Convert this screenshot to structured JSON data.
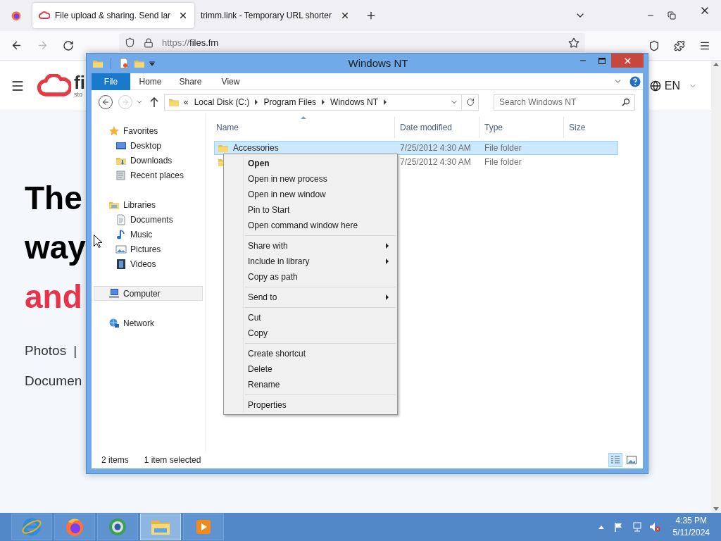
{
  "browser": {
    "tabs": [
      {
        "title": "File upload & sharing. Send lar",
        "selected": true
      },
      {
        "title": "trimm.link - Temporary URL shorter",
        "selected": false
      }
    ],
    "url": {
      "scheme": "https://",
      "host": "files.fm"
    }
  },
  "page": {
    "logo": {
      "text": "fi",
      "tagline": "sto"
    },
    "language": "EN",
    "headline": [
      {
        "text": "The",
        "highlight": false
      },
      {
        "text": "way",
        "highlight": false
      },
      {
        "text": "and",
        "highlight": true
      }
    ],
    "links": [
      "Photos",
      "|"
    ],
    "subline": "Documen"
  },
  "explorer": {
    "title": "Windows NT",
    "ribbon_tabs": [
      {
        "label": "File",
        "selected": true
      },
      {
        "label": "Home",
        "selected": false
      },
      {
        "label": "Share",
        "selected": false
      },
      {
        "label": "View",
        "selected": false
      }
    ],
    "breadcrumb": {
      "overflow": "«",
      "parts": [
        "Local Disk (C:)",
        "Program Files",
        "Windows NT"
      ]
    },
    "search": {
      "placeholder": "Search Windows NT"
    },
    "navigation": [
      {
        "label": "Favorites",
        "selected": false,
        "children": [
          {
            "label": "Desktop",
            "selected": false
          },
          {
            "label": "Downloads",
            "selected": false
          },
          {
            "label": "Recent places",
            "selected": false
          }
        ]
      },
      {
        "label": "Libraries",
        "selected": false,
        "children": [
          {
            "label": "Documents",
            "selected": false
          },
          {
            "label": "Music",
            "selected": false
          },
          {
            "label": "Pictures",
            "selected": false
          },
          {
            "label": "Videos",
            "selected": false
          }
        ]
      },
      {
        "label": "Computer",
        "selected": true
      },
      {
        "label": "Network",
        "selected": false
      }
    ],
    "columns": [
      "Name",
      "Date modified",
      "Type",
      "Size"
    ],
    "files": [
      {
        "name": "Accessories",
        "date": "7/25/2012 4:30 AM",
        "type": "File folder",
        "selected": true
      },
      {
        "date": "7/25/2012 4:30 AM",
        "type": "File folder",
        "selected": false
      }
    ],
    "status": {
      "count": "2 items",
      "selection": "1 item selected"
    },
    "views": [
      {
        "selected": true
      },
      {
        "selected": false
      }
    ]
  },
  "context_menu": {
    "groups": [
      [
        {
          "label": "Open",
          "default": true,
          "submenu": false
        },
        {
          "label": "Open in new process",
          "default": false,
          "submenu": false
        },
        {
          "label": "Open in new window",
          "default": false,
          "submenu": false
        },
        {
          "label": "Pin to Start",
          "default": false,
          "submenu": false
        },
        {
          "label": "Open command window here",
          "default": false,
          "submenu": false
        }
      ],
      [
        {
          "label": "Share with",
          "default": false,
          "submenu": true
        },
        {
          "label": "Include in library",
          "default": false,
          "submenu": true
        },
        {
          "label": "Copy as path",
          "default": false,
          "submenu": false
        }
      ],
      [
        {
          "label": "Send to",
          "default": false,
          "submenu": true
        }
      ],
      [
        {
          "label": "Cut",
          "default": false,
          "submenu": false
        },
        {
          "label": "Copy",
          "default": false,
          "submenu": false
        }
      ],
      [
        {
          "label": "Create shortcut",
          "default": false,
          "submenu": false
        },
        {
          "label": "Delete",
          "default": false,
          "submenu": false
        },
        {
          "label": "Rename",
          "default": false,
          "submenu": false
        }
      ],
      [
        {
          "label": "Properties",
          "default": false,
          "submenu": false
        }
      ]
    ]
  },
  "taskbar": {
    "apps": [
      {
        "selected": false
      },
      {
        "selected": false
      },
      {
        "selected": false
      },
      {
        "selected": true
      },
      {
        "selected": false
      }
    ],
    "clock": {
      "time": "4:35 PM",
      "date": "5/11/2024"
    }
  }
}
